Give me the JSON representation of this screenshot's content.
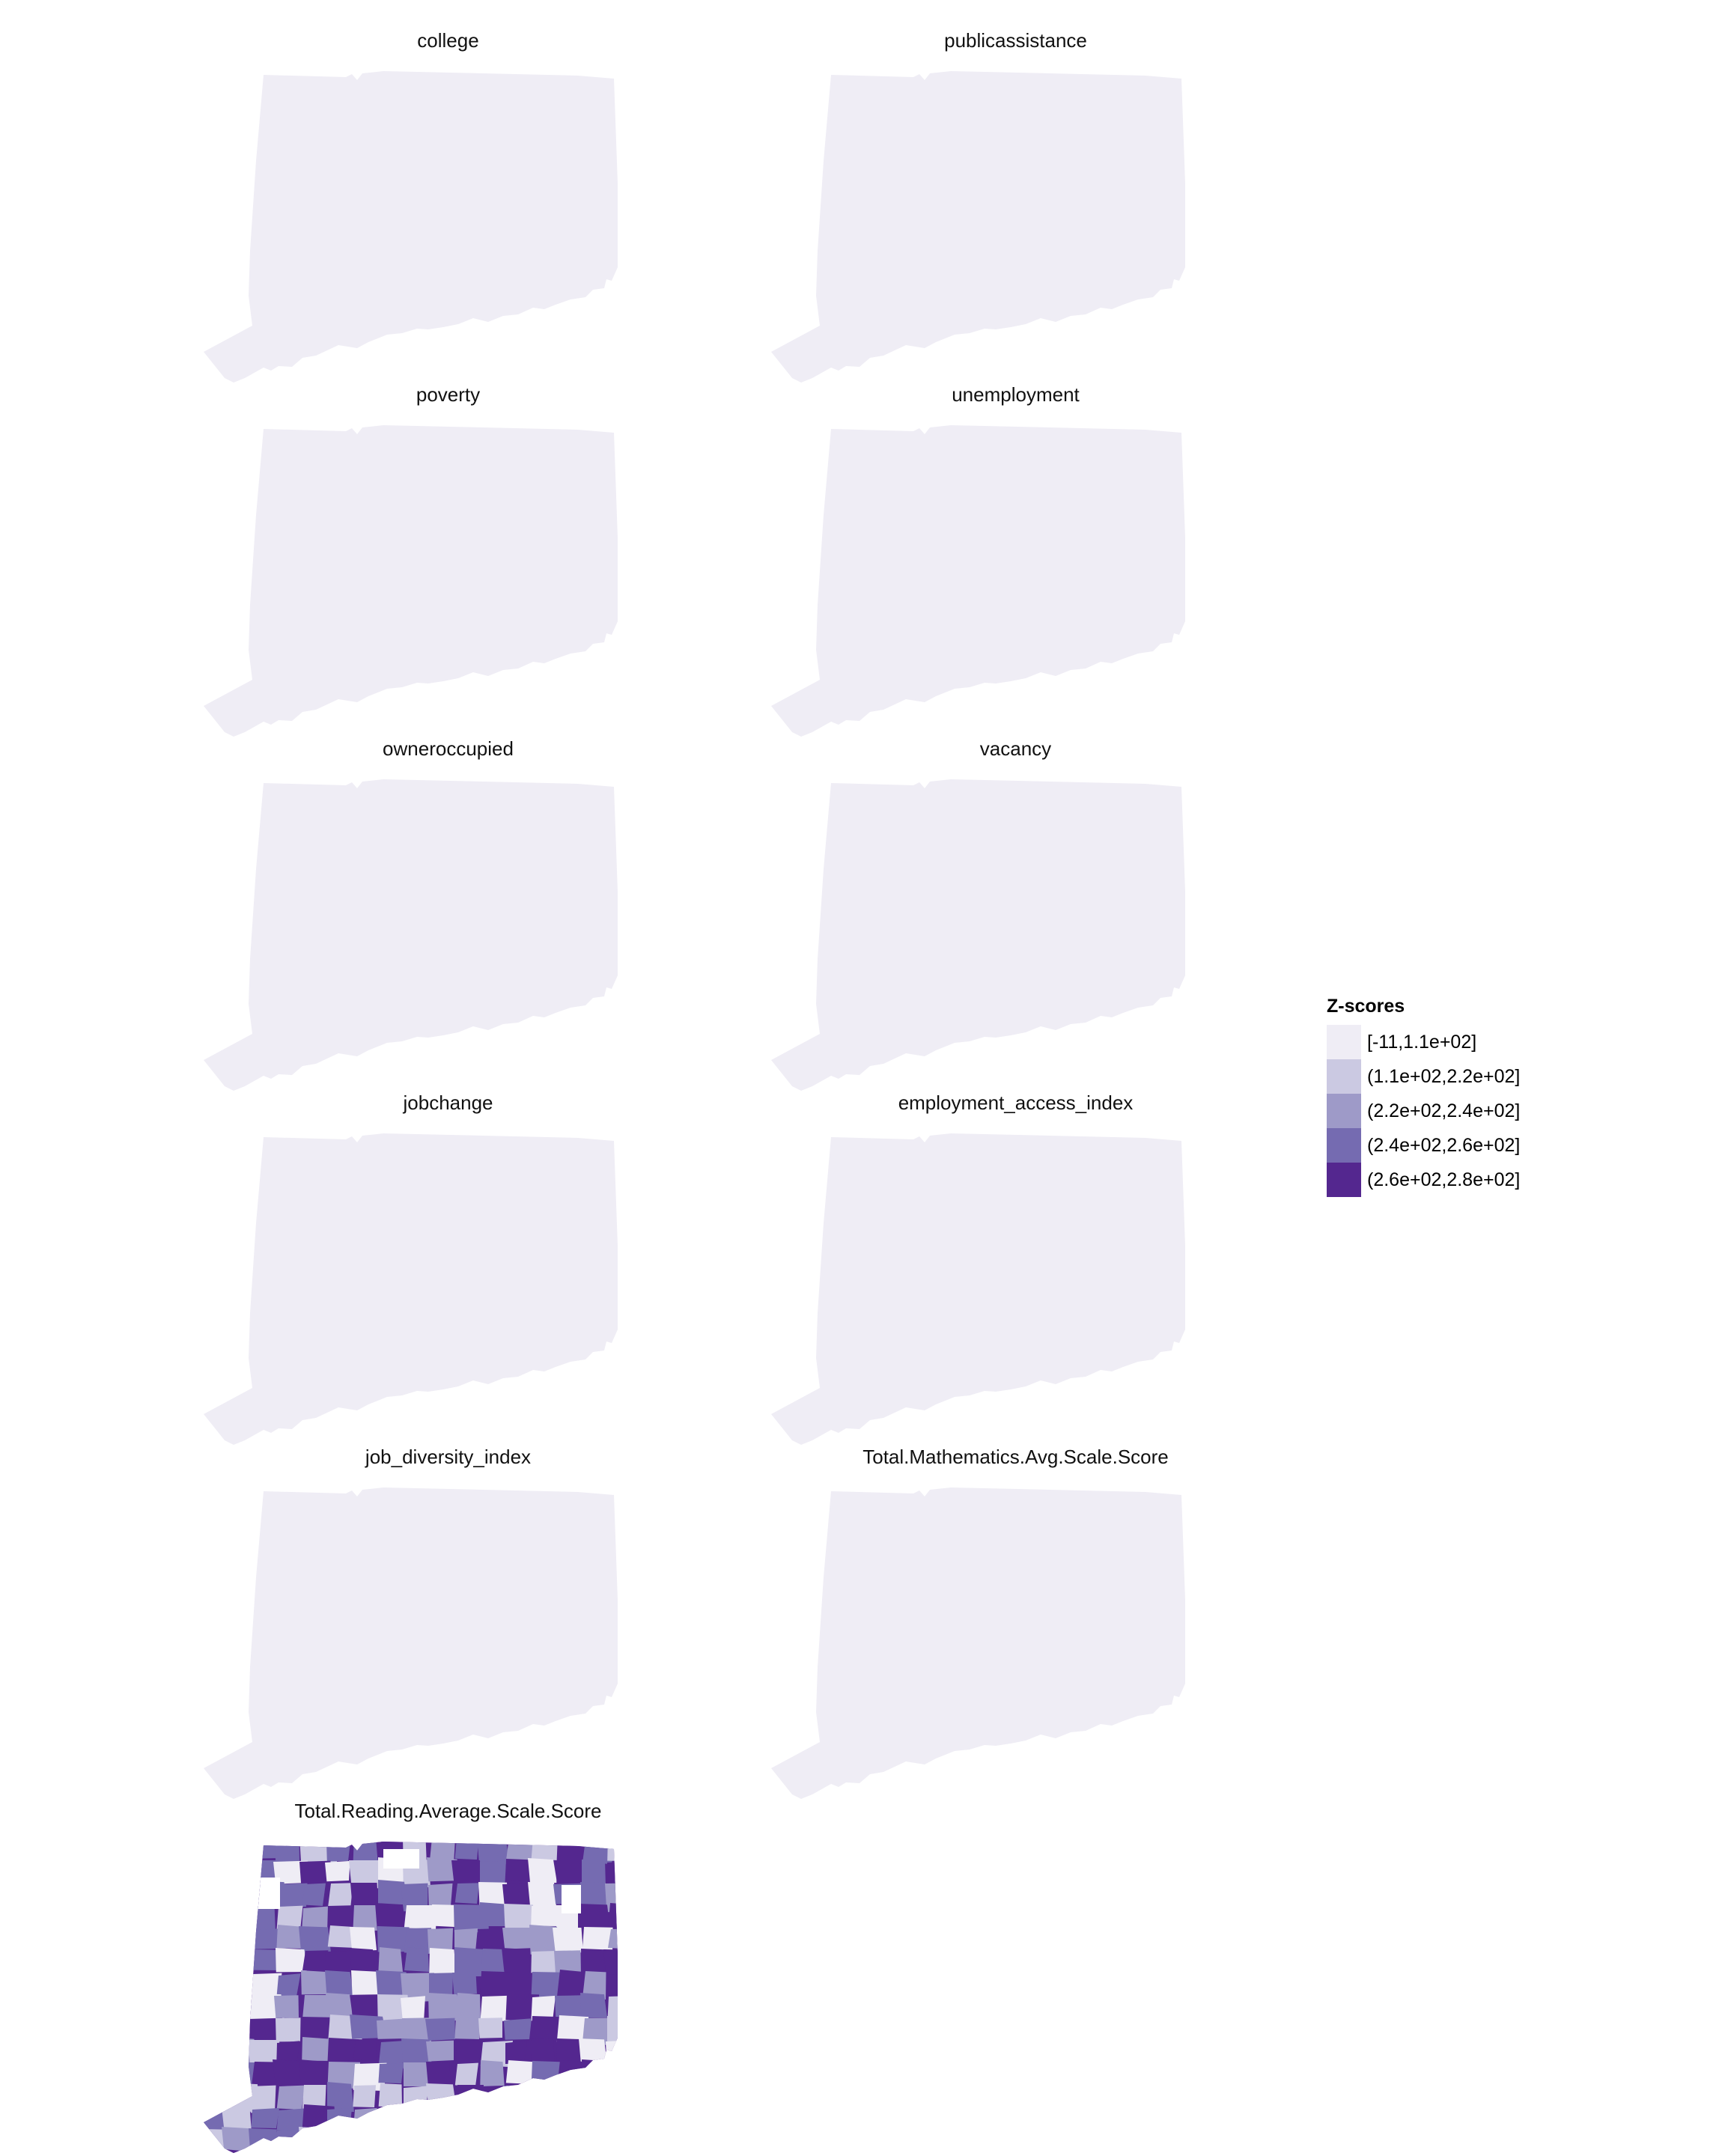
{
  "legend": {
    "title": "Z-scores",
    "items": [
      {
        "label": "[-11,1.1e+02]",
        "color": "#efedf5"
      },
      {
        "label": "(1.1e+02,2.2e+02]",
        "color": "#cbc9e2"
      },
      {
        "label": "(2.2e+02,2.4e+02]",
        "color": "#9e9ac8"
      },
      {
        "label": "(2.4e+02,2.6e+02]",
        "color": "#756bb1"
      },
      {
        "label": "(2.6e+02,2.8e+02]",
        "color": "#54278f"
      }
    ]
  },
  "facets": [
    {
      "title": "college",
      "fill": "uniform"
    },
    {
      "title": "publicassistance",
      "fill": "uniform"
    },
    {
      "title": "poverty",
      "fill": "uniform"
    },
    {
      "title": "unemployment",
      "fill": "uniform"
    },
    {
      "title": "owneroccupied",
      "fill": "uniform"
    },
    {
      "title": "vacancy",
      "fill": "uniform"
    },
    {
      "title": "jobchange",
      "fill": "uniform"
    },
    {
      "title": "employment_access_index",
      "fill": "uniform"
    },
    {
      "title": "job_diversity_index",
      "fill": "uniform"
    },
    {
      "title": "Total.Mathematics.Avg.Scale.Score",
      "fill": "uniform"
    },
    {
      "title": "Total.Reading.Average.Scale.Score",
      "fill": "choropleth"
    }
  ]
}
